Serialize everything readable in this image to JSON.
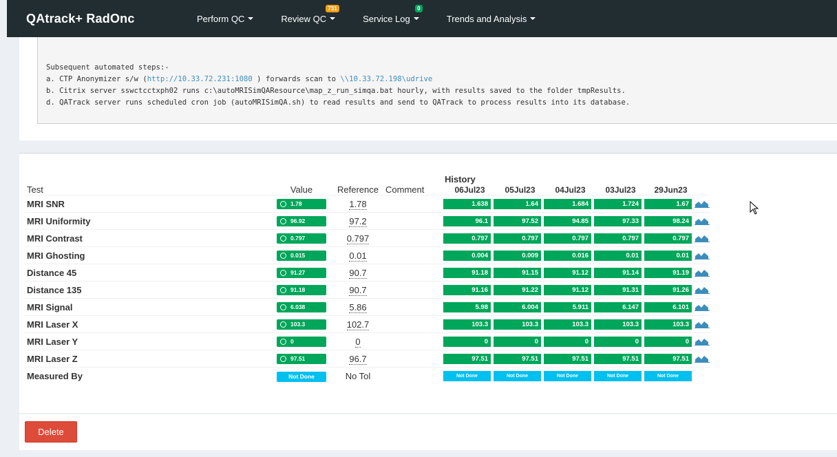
{
  "navbar": {
    "brand": "QAtrack+ RadOnc",
    "items": [
      {
        "label": "Perform QC",
        "badge": ""
      },
      {
        "label": "Review QC",
        "badge": "731"
      },
      {
        "label": "Service Log",
        "badge": "0"
      },
      {
        "label": "Trends and Analysis",
        "badge": ""
      }
    ]
  },
  "description": {
    "heading": "Subsequent automated steps:-",
    "line_a_prefix": "a. CTP Anonymizer s/w (",
    "line_a_link1": "http://10.33.72.231:1080",
    "line_a_mid": " ) forwards scan to ",
    "line_a_link2": "\\\\10.33.72.198\\udrive",
    "line_b": "b. Citrix server sswctcctxph02 runs c:\\autoMRISimQAResource\\map_z_run_simqa.bat hourly, with results saved to the folder tmpResults.",
    "line_d": "d. QATrack server runs scheduled cron job (autoMRISimQA.sh) to read results and send to QATrack to process results into its database."
  },
  "table": {
    "headers": {
      "test": "Test",
      "value": "Value",
      "reference": "Reference",
      "comment": "Comment",
      "history": "History"
    },
    "history_dates": [
      "06Jul23",
      "05Jul23",
      "04Jul23",
      "03Jul23",
      "29Jun23"
    ],
    "rows": [
      {
        "test": "MRI SNR",
        "value": "1.78",
        "reference": "1.78",
        "history": [
          "1.638",
          "1.64",
          "1.684",
          "1.724",
          "1.67"
        ]
      },
      {
        "test": "MRI Uniformity",
        "value": "96.92",
        "reference": "97.2",
        "history": [
          "96.1",
          "97.52",
          "94.85",
          "97.33",
          "98.24"
        ]
      },
      {
        "test": "MRI Contrast",
        "value": "0.797",
        "reference": "0.797",
        "history": [
          "0.797",
          "0.797",
          "0.797",
          "0.797",
          "0.797"
        ]
      },
      {
        "test": "MRI Ghosting",
        "value": "0.015",
        "reference": "0.01",
        "history": [
          "0.004",
          "0.009",
          "0.016",
          "0.01",
          "0.01"
        ]
      },
      {
        "test": "Distance 45",
        "value": "91.27",
        "reference": "90.7",
        "history": [
          "91.18",
          "91.15",
          "91.12",
          "91.14",
          "91.19"
        ]
      },
      {
        "test": "Distance 135",
        "value": "91.18",
        "reference": "90.7",
        "history": [
          "91.16",
          "91.22",
          "91.12",
          "91.31",
          "91.26"
        ]
      },
      {
        "test": "MRI Signal",
        "value": "6.038",
        "reference": "5.86",
        "history": [
          "5.98",
          "6.004",
          "5.911",
          "6.147",
          "6.101"
        ]
      },
      {
        "test": "MRI Laser X",
        "value": "103.3",
        "reference": "102.7",
        "history": [
          "103.3",
          "103.3",
          "103.3",
          "103.3",
          "103.3"
        ]
      },
      {
        "test": "MRI Laser Y",
        "value": "0",
        "reference": "0",
        "history": [
          "0",
          "0",
          "0",
          "0",
          "0"
        ]
      },
      {
        "test": "MRI Laser Z",
        "value": "97.51",
        "reference": "96.7",
        "history": [
          "97.51",
          "97.51",
          "97.51",
          "97.51",
          "97.51"
        ]
      }
    ],
    "measured_by": {
      "test": "Measured By",
      "value": "Not Done",
      "reference": "No Tol",
      "history": [
        "Not Done",
        "Not Done",
        "Not Done",
        "Not Done",
        "Not Done"
      ]
    }
  },
  "actions": {
    "delete_label": "Delete"
  },
  "colors": {
    "ok": "#00a65a",
    "not_done": "#00c0ef",
    "danger": "#dd4b39",
    "navbar": "#222d32",
    "link": "#3c8dbc"
  }
}
